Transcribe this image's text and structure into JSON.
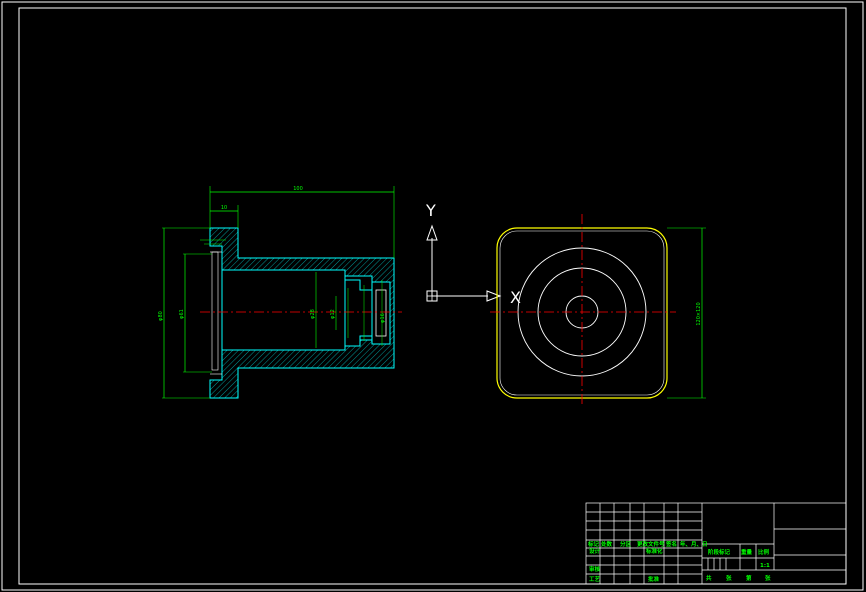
{
  "drawing": {
    "dims": {
      "overall_length": "100",
      "flange_width": "10",
      "left_total_height": "φ80",
      "left_inner_height": "φ61",
      "bore_dia": "φ28",
      "small_bore": "φ12",
      "right_features": "φ16",
      "square_width": "120×120"
    },
    "ucs": {
      "x_label": "X",
      "y_label": "Y"
    }
  },
  "title_block": {
    "row1": [
      "标记",
      "处数",
      "分区",
      "更改文件号",
      "签名",
      "年、月、日"
    ],
    "row2": [
      "设计",
      "标准化"
    ],
    "row3": [
      "审核"
    ],
    "row4": [
      "工艺",
      "批准"
    ],
    "right_labels": [
      "阶段标记",
      "重量",
      "比例"
    ],
    "scale": "1:1",
    "sheet_labels": [
      "共",
      "张",
      "第",
      "张"
    ]
  },
  "colors": {
    "background": "#000000",
    "part_lines": "#00ffff",
    "dimension": "#00ff00",
    "center": "#ff0000",
    "circles": "#ffffff",
    "outline": "#ffff00"
  }
}
